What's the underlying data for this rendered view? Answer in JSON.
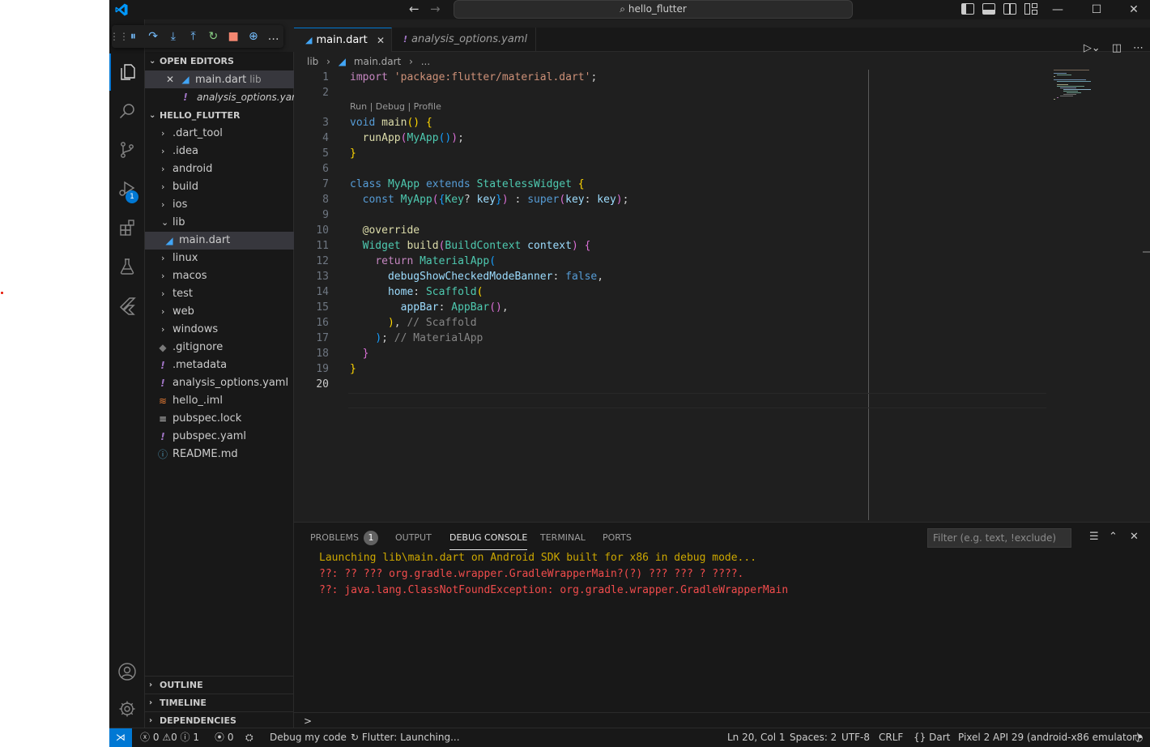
{
  "title_bar": {
    "search_text": "hello_flutter",
    "window_controls": [
      "minimize",
      "maximize",
      "close"
    ]
  },
  "activity_bar": {
    "debug_badge": "1"
  },
  "sidebar": {
    "open_editors_header": "OPEN EDITORS",
    "open_editors": [
      {
        "name": "main.dart",
        "desc": "lib",
        "icon": "dart-icon"
      },
      {
        "name": "analysis_options.yaml",
        "desc": "",
        "icon": "exclamation-icon"
      }
    ],
    "project_header": "HELLO_FLUTTER",
    "tree": [
      {
        "name": ".dart_tool",
        "type": "folder"
      },
      {
        "name": ".idea",
        "type": "folder"
      },
      {
        "name": "android",
        "type": "folder"
      },
      {
        "name": "build",
        "type": "folder"
      },
      {
        "name": "ios",
        "type": "folder"
      },
      {
        "name": "lib",
        "type": "folder-open"
      },
      {
        "name": "main.dart",
        "type": "file"
      },
      {
        "name": "linux",
        "type": "folder"
      },
      {
        "name": "macos",
        "type": "folder"
      },
      {
        "name": "test",
        "type": "folder"
      },
      {
        "name": "web",
        "type": "folder"
      },
      {
        "name": "windows",
        "type": "folder"
      },
      {
        "name": ".gitignore",
        "type": "file"
      },
      {
        "name": ".metadata",
        "type": "file"
      },
      {
        "name": "analysis_options.yaml",
        "type": "file"
      },
      {
        "name": "hello_.iml",
        "type": "file"
      },
      {
        "name": "pubspec.lock",
        "type": "file"
      },
      {
        "name": "pubspec.yaml",
        "type": "file"
      },
      {
        "name": "README.md",
        "type": "file"
      }
    ],
    "outline_header": "OUTLINE",
    "timeline_header": "TIMELINE",
    "dependencies_header": "DEPENDENCIES"
  },
  "editor": {
    "tabs": [
      {
        "label": "main.dart",
        "active": true
      },
      {
        "label": "analysis_options.yaml",
        "active": false
      }
    ],
    "breadcrumbs": [
      "lib",
      "main.dart",
      "..."
    ],
    "codelens": "Run | Debug | Profile",
    "line_numbers": [
      "1",
      "2",
      "3",
      "4",
      "5",
      "6",
      "7",
      "8",
      "9",
      "10",
      "11",
      "12",
      "13",
      "14",
      "15",
      "16",
      "17",
      "18",
      "19",
      "20"
    ],
    "active_line": "20"
  },
  "panel": {
    "tabs": {
      "problems": "PROBLEMS",
      "problems_count": "1",
      "output": "OUTPUT",
      "debug_console": "DEBUG CONSOLE",
      "terminal": "TERMINAL",
      "ports": "PORTS"
    },
    "filter_placeholder": "Filter (e.g. text, !exclude)",
    "console_lines": [
      "Launching lib\\main.dart on Android SDK built for x86 in debug mode...",
      "??: ?? ??? org.gradle.wrapper.GradleWrapperMain?(?) ??? ??? ? ????.",
      "??: java.lang.ClassNotFoundException: org.gradle.wrapper.GradleWrapperMain"
    ],
    "prompt": ">"
  },
  "status_bar": {
    "errors": "0",
    "warnings": "0",
    "infos": "1",
    "ports": "0",
    "debug_label": "Debug my code",
    "flutter_status": "Flutter: Launching...",
    "position": "Ln 20, Col 1",
    "spaces": "Spaces: 2",
    "encoding": "UTF-8",
    "eol": "CRLF",
    "language": "Dart",
    "device": "Pixel 2 API 29 (android-x86 emulator)"
  },
  "colors": {
    "accent": "#0078d4",
    "error": "#f14c4c",
    "warning": "#cca700"
  }
}
